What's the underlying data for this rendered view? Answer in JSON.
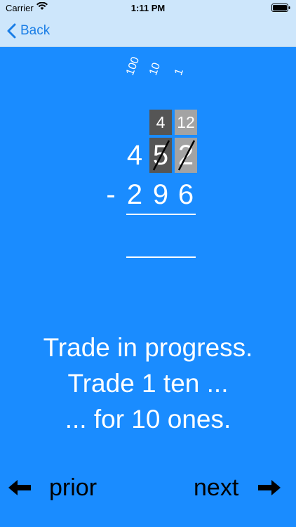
{
  "status": {
    "carrier": "Carrier",
    "time": "1:11 PM"
  },
  "nav": {
    "back_label": "Back"
  },
  "problem": {
    "place_values": [
      "100",
      "10",
      "1"
    ],
    "traded": {
      "tens": "4",
      "ones": "12"
    },
    "top_number": [
      "4",
      "5",
      "2"
    ],
    "operator": "-",
    "bottom_number": [
      "2",
      "9",
      "6"
    ]
  },
  "message": {
    "line1": "Trade in progress.",
    "line2": "Trade 1 ten ...",
    "line3": "... for 10 ones."
  },
  "footer": {
    "prior_label": "prior",
    "next_label": "next"
  }
}
